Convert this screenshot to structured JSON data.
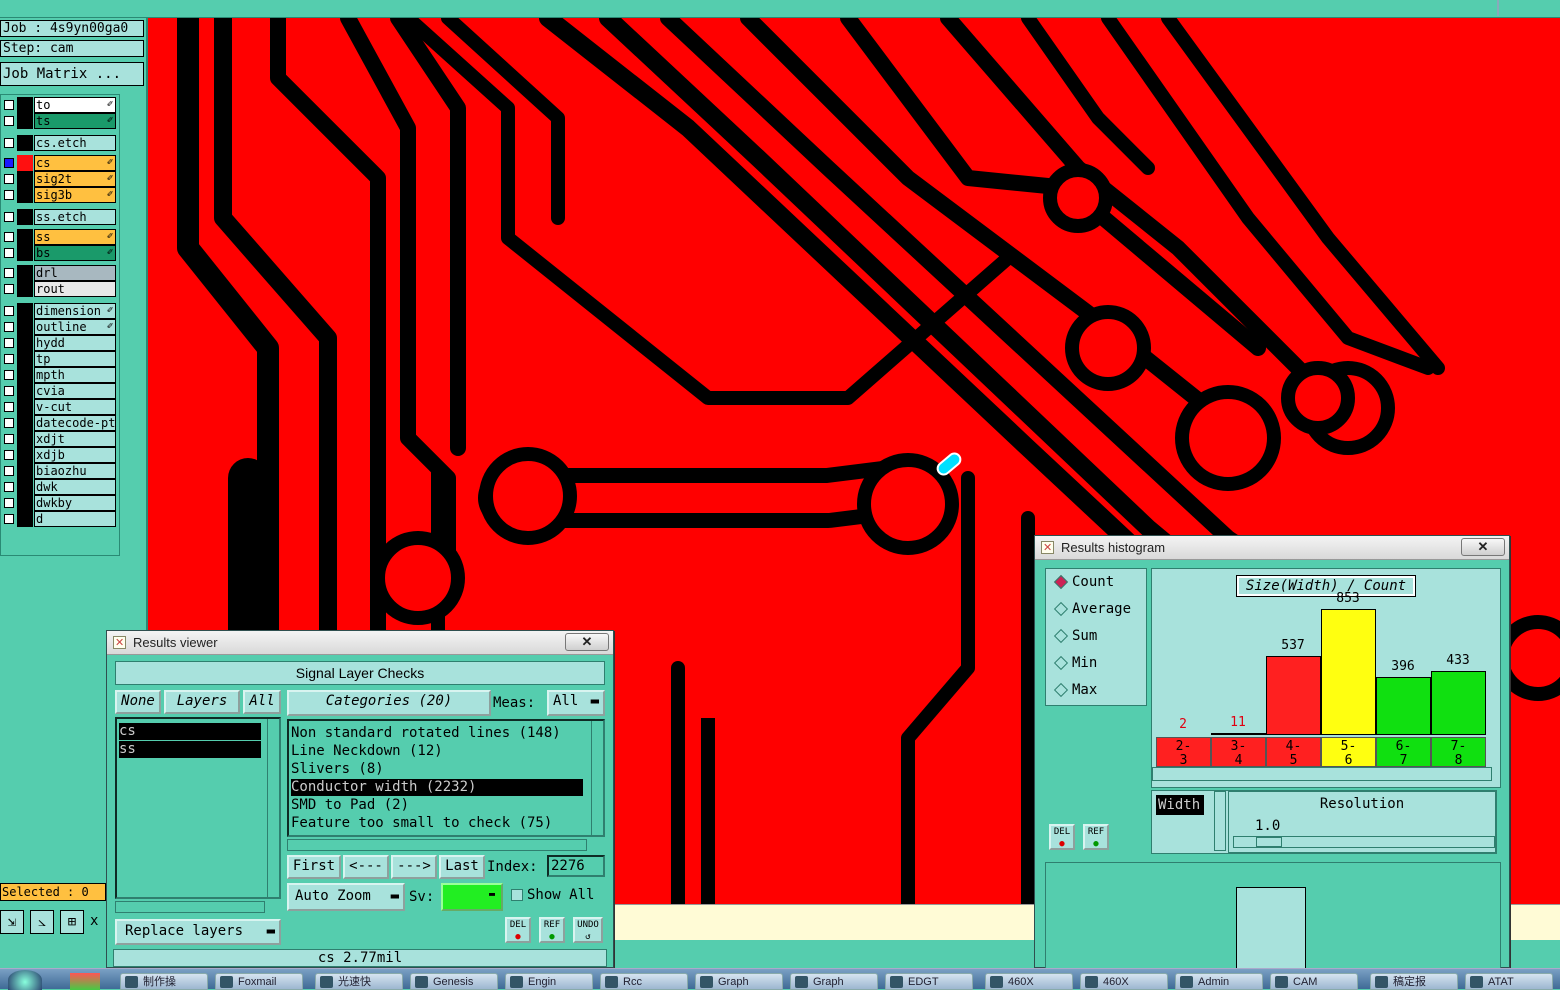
{
  "left_panel": {
    "job": "Job : 4s9yn00ga0",
    "step": "Step: cam",
    "job_matrix": "Job Matrix ...",
    "layers": [
      {
        "name": "to",
        "color": "#ffffff",
        "pen": true
      },
      {
        "name": "ts",
        "color": "#1a9a6a",
        "pen": true
      },
      {
        "name": "cs.etch",
        "color": "#a8e2dc",
        "pen": false
      },
      {
        "name": "cs",
        "color": "#ffc040",
        "pen": true,
        "active": true
      },
      {
        "name": "sig2t",
        "color": "#ffc040",
        "pen": true
      },
      {
        "name": "sig3b",
        "color": "#ffc040",
        "pen": true
      },
      {
        "name": "ss.etch",
        "color": "#a8e2dc",
        "pen": false
      },
      {
        "name": "ss",
        "color": "#ffc040",
        "pen": true
      },
      {
        "name": "bs",
        "color": "#1a9a6a",
        "pen": true
      },
      {
        "name": "drl",
        "color": "#a8b8c0",
        "pen": false
      },
      {
        "name": "rout",
        "color": "#e8e8e8",
        "pen": false
      },
      {
        "name": "dimension",
        "color": "#a8e2dc",
        "pen": true
      },
      {
        "name": "outline",
        "color": "#a8e2dc",
        "pen": true
      },
      {
        "name": "hydd",
        "color": "#a8e2dc",
        "pen": false
      },
      {
        "name": "tp",
        "color": "#a8e2dc",
        "pen": false
      },
      {
        "name": "mpth",
        "color": "#a8e2dc",
        "pen": false
      },
      {
        "name": "cvia",
        "color": "#a8e2dc",
        "pen": false
      },
      {
        "name": "v-cut",
        "color": "#a8e2dc",
        "pen": false
      },
      {
        "name": "datecode-ptc",
        "color": "#a8e2dc",
        "pen": false
      },
      {
        "name": "xdjt",
        "color": "#a8e2dc",
        "pen": false
      },
      {
        "name": "xdjb",
        "color": "#a8e2dc",
        "pen": false
      },
      {
        "name": "biaozhu",
        "color": "#a8e2dc",
        "pen": false
      },
      {
        "name": "dwk",
        "color": "#a8e2dc",
        "pen": false
      },
      {
        "name": "dwkby",
        "color": "#a8e2dc",
        "pen": false
      },
      {
        "name": "d",
        "color": "#a8e2dc",
        "pen": false
      }
    ],
    "selected": "Selected : 0",
    "x_label": "x"
  },
  "results_viewer": {
    "title": "Results viewer",
    "close": "✕",
    "header": "Signal Layer Checks",
    "none_btn": "None",
    "layers_btn": "Layers",
    "all_btn": "All",
    "layers": [
      "cs",
      "ss"
    ],
    "categories_btn": "Categories (20)",
    "meas_label": "Meas:",
    "meas_value": "All",
    "checks": [
      "Non standard rotated lines (148)",
      "Line Neckdown (12)",
      "Slivers (8)",
      "Conductor width (2232)",
      "SMD to Pad (2)",
      "Feature too small to check (75)"
    ],
    "selected_check": 3,
    "first_btn": "First",
    "prev_btn": "<---",
    "next_btn": "--->",
    "last_btn": "Last",
    "index_label": "Index:",
    "index_value": "2276",
    "auto_zoom": "Auto Zoom",
    "sv_label": "Sv:",
    "show_all": "Show All",
    "replace_layers": "Replace layers",
    "del": "DEL",
    "ref": "REF",
    "undo": "UNDO",
    "status": "cs 2.77mil"
  },
  "histogram": {
    "title": "Results histogram",
    "close": "✕",
    "modes": [
      "Count",
      "Average",
      "Sum",
      "Min",
      "Max"
    ],
    "selected_mode": 0,
    "del": "DEL",
    "ref": "REF",
    "width_label": "Width",
    "resolution_label": "Resolution",
    "resolution_value": "1.0",
    "colors": {
      "red": "#ff2020",
      "yellow": "#ffff10",
      "green": "#10e010"
    }
  },
  "chart_data": {
    "type": "bar",
    "title": "Size(Width) / Count",
    "categories": [
      "2-3",
      "3-4",
      "4-5",
      "5-6",
      "6-7",
      "7-8"
    ],
    "values": [
      2,
      11,
      537,
      853,
      396,
      433
    ],
    "bar_colors": [
      "#ff2020",
      "#ff2020",
      "#ff2020",
      "#ffff10",
      "#10e010",
      "#10e010"
    ],
    "ylim": [
      0,
      853
    ]
  },
  "taskbar": {
    "items": [
      "制作操",
      "Foxmail",
      "光速快",
      "Genesis",
      "Engin",
      "Rcc",
      "Graph",
      "Graph",
      "EDGT",
      "460X",
      "460X",
      "Admin",
      "CAM",
      "稿定报",
      "ATAT"
    ]
  }
}
